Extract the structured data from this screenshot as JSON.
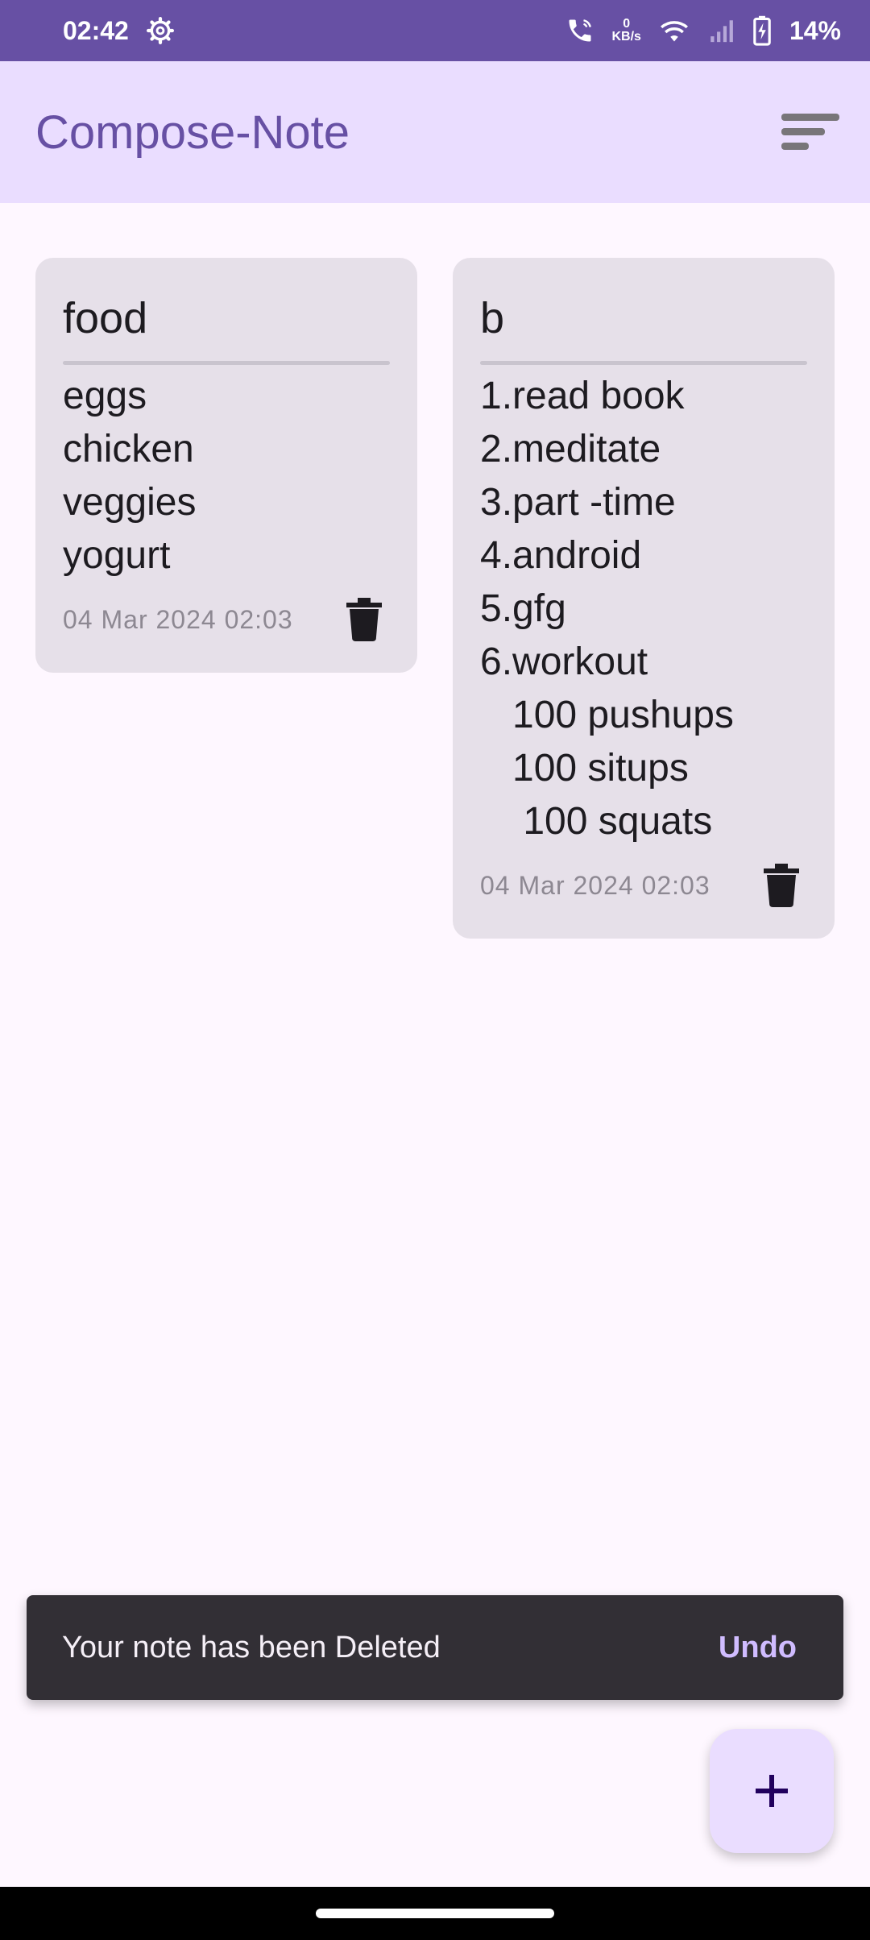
{
  "status_bar": {
    "time": "02:42",
    "net_speed_value": "0",
    "net_speed_unit": "KB/s",
    "battery": "14%"
  },
  "app_bar": {
    "title": "Compose-Note",
    "sort_icon": "sort-lines-icon"
  },
  "notes": [
    {
      "title": "food",
      "body": "eggs\nchicken\nveggies\nyogurt",
      "date": "04 Mar 2024 02:03"
    },
    {
      "title": "b",
      "body": "1.read book\n2.meditate\n3.part -time\n4.android\n5.gfg\n6.workout\n   100 pushups\n   100 situps\n    100 squats",
      "date": "04 Mar 2024 02:03"
    }
  ],
  "snackbar": {
    "message": "Your note has been Deleted",
    "action": "Undo"
  },
  "fab": {
    "icon": "plus-icon"
  },
  "colors": {
    "primary": "#6750a4",
    "primary_container": "#eaddff",
    "card": "#e6e0e9",
    "snackbar_bg": "#322f35",
    "snackbar_action": "#d0bcff"
  }
}
